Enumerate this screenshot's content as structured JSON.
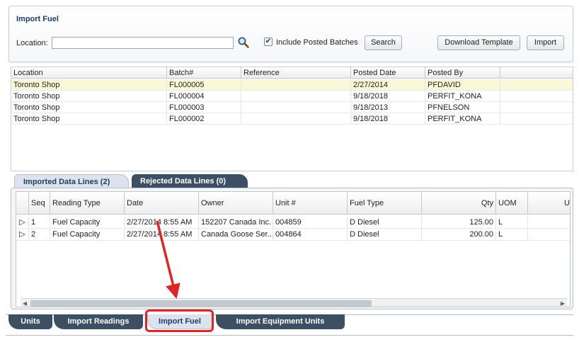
{
  "panel": {
    "title": "Import Fuel",
    "location_label": "Location:",
    "location_value": "",
    "include_posted_label": "Include Posted Batches",
    "include_posted_checked": true,
    "search_button": "Search",
    "download_button": "Download Template",
    "import_button": "Import"
  },
  "batches": {
    "columns": [
      "Location",
      "Batch#",
      "Reference",
      "Posted Date",
      "Posted By"
    ],
    "rows": [
      {
        "location": "Toronto Shop",
        "batch": "FL000005",
        "reference": "",
        "posted_date": "2/27/2014",
        "posted_by": "PFDAVID"
      },
      {
        "location": "Toronto Shop",
        "batch": "FL000004",
        "reference": "",
        "posted_date": "9/18/2018",
        "posted_by": "PERFIT_KONA"
      },
      {
        "location": "Toronto Shop",
        "batch": "FL000003",
        "reference": "",
        "posted_date": "9/18/2013",
        "posted_by": "PFNELSON"
      },
      {
        "location": "Toronto Shop",
        "batch": "FL000002",
        "reference": "",
        "posted_date": "9/18/2018",
        "posted_by": "PERFIT_KONA"
      }
    ]
  },
  "subtabs": {
    "imported": "Imported Data Lines (2)",
    "rejected": "Rejected Data Lines (0)"
  },
  "lines": {
    "columns": [
      "Seq",
      "Reading Type",
      "Date",
      "Owner",
      "Unit #",
      "Fuel Type",
      "Qty",
      "UOM",
      "U"
    ],
    "rows": [
      {
        "expander": "▷",
        "seq": "1",
        "reading_type": "Fuel Capacity",
        "date": "2/27/2014 8:55 AM",
        "owner": "152207 Canada Inc.",
        "unit": "004859",
        "fuel_type": "D Diesel",
        "qty": "125.00",
        "uom": "L"
      },
      {
        "expander": "▷",
        "seq": "2",
        "reading_type": "Fuel Capacity",
        "date": "2/27/2014 8:55 AM",
        "owner": "Canada Goose Ser...",
        "unit": "004864",
        "fuel_type": "D Diesel",
        "qty": "200.00",
        "uom": "L"
      }
    ]
  },
  "bottom_tabs": [
    "Units",
    "Import Readings",
    "Import Fuel",
    "Import Equipment Units"
  ],
  "colors": {
    "accent_red": "#e02323",
    "selected_row": "#fbf7d9",
    "tab_dark": "#3d4f63",
    "title_blue": "#1d3c66"
  }
}
